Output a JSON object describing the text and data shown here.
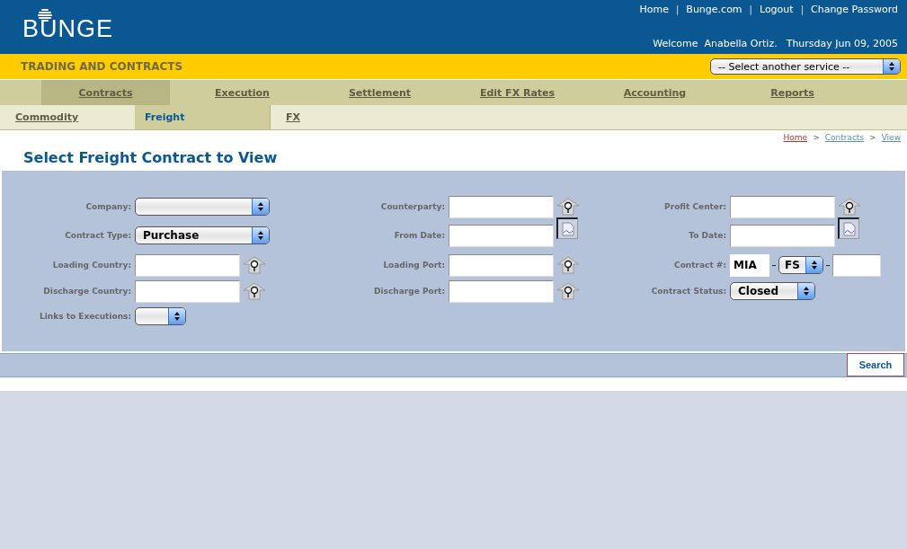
{
  "header": {
    "logo": "BUNGE",
    "links": [
      {
        "kind": "link",
        "text": "Home"
      },
      {
        "kind": "separator",
        "text": "|"
      },
      {
        "kind": "link",
        "text": "Bunge.com"
      },
      {
        "kind": "separator",
        "text": "|"
      },
      {
        "kind": "link",
        "text": "Logout"
      },
      {
        "kind": "separator",
        "text": "|"
      },
      {
        "kind": "link",
        "text": "Change Password"
      }
    ],
    "welcome": "Welcome  Anabella Ortiz.",
    "date": "Thursday Jun 09, 2005"
  },
  "service_bar": {
    "title": "TRADING AND CONTRACTS",
    "service_select": "-- Select another service --"
  },
  "main_tabs": [
    {
      "label": "Contracts",
      "selected": true
    },
    {
      "label": "Execution",
      "selected": false
    },
    {
      "label": "Settlement",
      "selected": false
    },
    {
      "label": "Edit FX Rates",
      "selected": false
    },
    {
      "label": "Accounting",
      "selected": false
    },
    {
      "label": "Reports",
      "selected": false
    }
  ],
  "sub_tabs": [
    {
      "label": "Commodity",
      "selected": false
    },
    {
      "label": "Freight",
      "selected": true
    },
    {
      "label": "FX",
      "selected": false
    }
  ],
  "breadcrumb": [
    {
      "kind": "link",
      "text": "Home",
      "visited": true
    },
    {
      "kind": "separator",
      "text": ">"
    },
    {
      "kind": "link",
      "text": "Contracts",
      "visited": false
    },
    {
      "kind": "separator",
      "text": ">"
    },
    {
      "kind": "link",
      "text": "View",
      "visited": false
    }
  ],
  "page_title": "Select Freight Contract to View",
  "form": {
    "rows": [
      [
        {
          "label": "Company:",
          "kind": "select"
        },
        {
          "label": "Counterparty:",
          "kind": "lookup"
        },
        {
          "label": "Profit Center:",
          "kind": "lookup"
        }
      ],
      [
        {
          "label": "Contract Type:",
          "kind": "select",
          "value": "Purchase"
        },
        {
          "label": "From Date:",
          "kind": "date"
        },
        {
          "label": "To Date:",
          "kind": "date"
        }
      ],
      [
        {
          "label": "Loading Country:",
          "kind": "lookup"
        },
        {
          "label": "Loading Port:",
          "kind": "lookup"
        },
        {
          "label": "Contract #:",
          "kind": "contract_number",
          "prefix": "MIA",
          "type": "FS"
        }
      ],
      [
        {
          "label": "Discharge Country:",
          "kind": "lookup"
        },
        {
          "label": "Discharge Port:",
          "kind": "lookup"
        },
        {
          "label": "Contract Status:",
          "kind": "select",
          "value": "Closed"
        }
      ],
      [
        {
          "label": "Links to Executions:",
          "kind": "select"
        }
      ]
    ],
    "search_button": "Search"
  }
}
